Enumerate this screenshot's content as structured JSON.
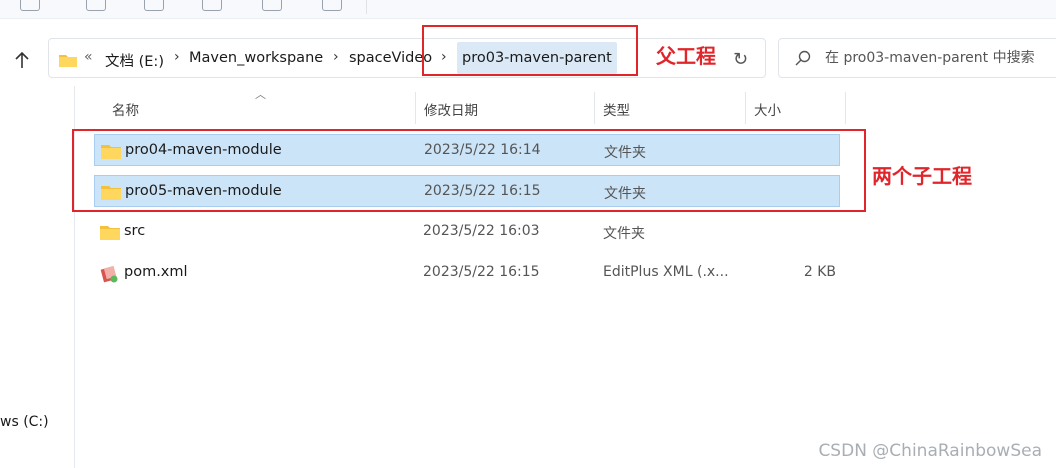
{
  "address": {
    "overflow_glyph": "«",
    "breadcrumbs": [
      "文档 (E:)",
      "Maven_workspane",
      "spaceVideo"
    ],
    "current": "pro03-maven-parent",
    "separator": "›",
    "refresh_icon": "refresh-icon"
  },
  "search": {
    "placeholder": "在 pro03-maven-parent 中搜索"
  },
  "nav_pane": {
    "drive_label": "ws (C:)"
  },
  "columns": {
    "name": "名称",
    "date": "修改日期",
    "type": "类型",
    "size": "大小"
  },
  "files": [
    {
      "name": "pro04-maven-module",
      "date": "2023/5/22 16:14",
      "type": "文件夹",
      "size": "",
      "icon": "folder-icon",
      "selected": true
    },
    {
      "name": "pro05-maven-module",
      "date": "2023/5/22 16:15",
      "type": "文件夹",
      "size": "",
      "icon": "folder-icon",
      "selected": true
    },
    {
      "name": "src",
      "date": "2023/5/22 16:03",
      "type": "文件夹",
      "size": "",
      "icon": "folder-icon",
      "selected": false
    },
    {
      "name": "pom.xml",
      "date": "2023/5/22 16:15",
      "type": "EditPlus XML (.x...",
      "size": "2 KB",
      "icon": "xml-file-icon",
      "selected": false
    }
  ],
  "annotations": {
    "parent_label": "父工程",
    "children_label": "两个子工程",
    "color": "#e0262b"
  },
  "watermark": "CSDN @ChinaRainbowSea"
}
